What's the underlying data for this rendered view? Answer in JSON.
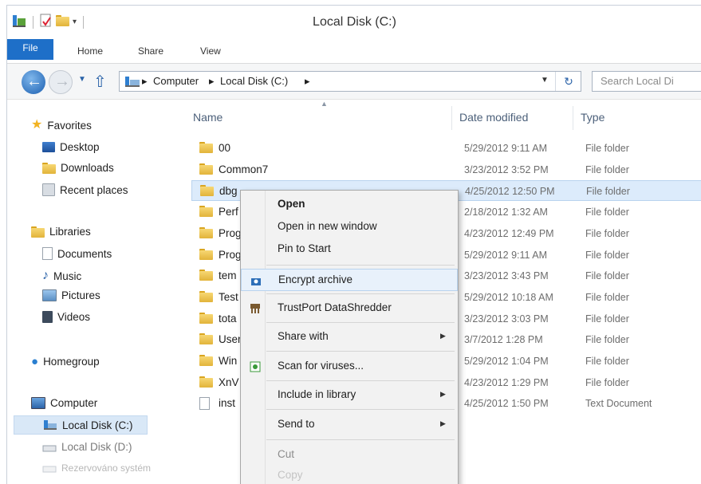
{
  "window": {
    "title": "Local Disk (C:)"
  },
  "ribbon": {
    "tabs": [
      "File",
      "Home",
      "Share",
      "View"
    ]
  },
  "address": {
    "crumbs": [
      "Computer",
      "Local Disk (C:)"
    ],
    "search_placeholder": "Search Local Di"
  },
  "columns": {
    "name": "Name",
    "date": "Date modified",
    "type": "Type"
  },
  "nav": {
    "favorites": "Favorites",
    "desktop": "Desktop",
    "downloads": "Downloads",
    "recent": "Recent places",
    "libraries": "Libraries",
    "documents": "Documents",
    "music": "Music",
    "pictures": "Pictures",
    "videos": "Videos",
    "homegroup": "Homegroup",
    "computer": "Computer",
    "disk_c": "Local Disk (C:)",
    "disk_d": "Local Disk (D:)",
    "reserved": "Rezervováno systém"
  },
  "files": [
    {
      "name": "00",
      "date": "5/29/2012 9:11 AM",
      "type": "File folder"
    },
    {
      "name": "Common7",
      "date": "3/23/2012 3:52 PM",
      "type": "File folder"
    },
    {
      "name": "dbg",
      "date": "4/25/2012 12:50 PM",
      "type": "File folder"
    },
    {
      "name": "Perf",
      "date": "2/18/2012 1:32 AM",
      "type": "File folder"
    },
    {
      "name": "Prog",
      "date": "4/23/2012 12:49 PM",
      "type": "File folder"
    },
    {
      "name": "Prog",
      "date": "5/29/2012 9:11 AM",
      "type": "File folder"
    },
    {
      "name": "tem",
      "date": "3/23/2012 3:43 PM",
      "type": "File folder"
    },
    {
      "name": "Test",
      "date": "5/29/2012 10:18 AM",
      "type": "File folder"
    },
    {
      "name": "tota",
      "date": "3/23/2012 3:03 PM",
      "type": "File folder"
    },
    {
      "name": "User",
      "date": "3/7/2012 1:28 PM",
      "type": "File folder"
    },
    {
      "name": "Win",
      "date": "5/29/2012 1:04 PM",
      "type": "File folder"
    },
    {
      "name": "XnV",
      "date": "4/23/2012 1:29 PM",
      "type": "File folder"
    },
    {
      "name": "inst",
      "date": "4/25/2012 1:50 PM",
      "type": "Text Document"
    }
  ],
  "context_menu": {
    "open": "Open",
    "open_new": "Open in new window",
    "pin": "Pin to Start",
    "encrypt": "Encrypt archive",
    "shredder": "TrustPort DataShredder",
    "share": "Share with",
    "scan": "Scan for viruses...",
    "include": "Include in library",
    "send": "Send to",
    "cut": "Cut",
    "copy": "Copy"
  }
}
